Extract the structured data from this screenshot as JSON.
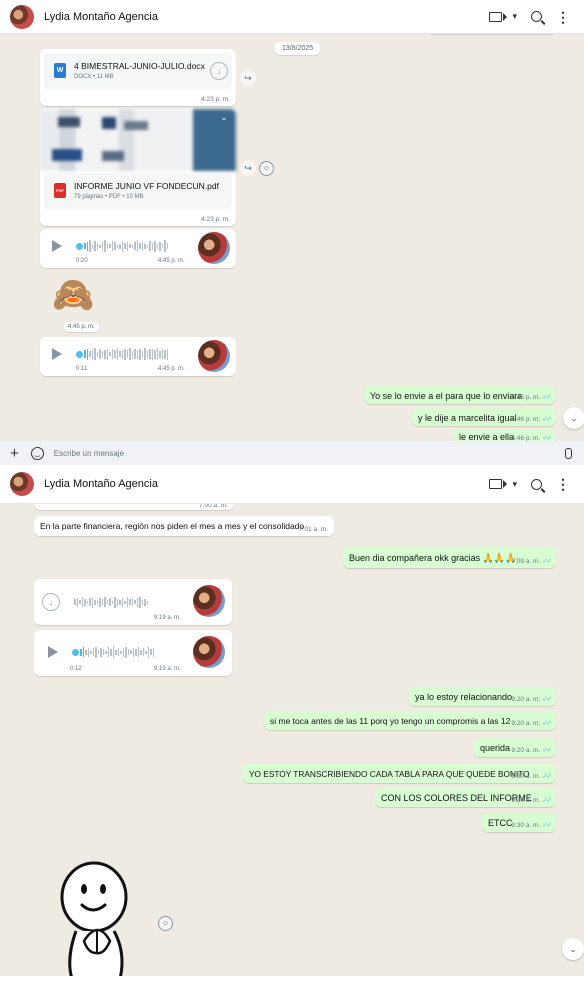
{
  "header": {
    "contact_name": "Lydia Montaño Agencia"
  },
  "pane1": {
    "date_chip": "13/8/2025",
    "doc1": {
      "name": "4 BIMESTRAL-JUNIO-JULIO.docx",
      "meta": "DOCX • 11 MB",
      "time": "4:23 p. m.",
      "icon_label": "W"
    },
    "doc2": {
      "name": "INFORME JUNIO VF FONDECUN.pdf",
      "meta": "79 páginas • PDF • 10 MB",
      "time": "4:23 p. m.",
      "icon_label": "PDF"
    },
    "voice1": {
      "duration": "0:20",
      "time": "4:45 p. m."
    },
    "monkey": {
      "emoji": "🙈",
      "time": "4:45 p. m."
    },
    "voice2": {
      "duration": "0:11",
      "time": "4:45 p. m."
    },
    "out_msgs": [
      {
        "text": "Yo se lo envie a el para que lo enviara",
        "time": "4:46 p. m."
      },
      {
        "text": "y le dije a marcelita igual",
        "time": "4:46 p. m."
      },
      {
        "text": "le envie a ella",
        "time": "4:46 p. m."
      }
    ],
    "composer_placeholder": "Escribe un mensaje"
  },
  "pane2": {
    "top_time": "7:00 a. m.",
    "in_msg": {
      "text": "En la parte financiera, región  nos piden el mes a mes y el consolidado",
      "time": "7:01 a. m."
    },
    "out_msg1": {
      "text": "Buen dia compañera okk gracias 🙏🙏🙏",
      "time": "7:09 a. m."
    },
    "voice1": {
      "time": "9:19 a. m."
    },
    "voice2": {
      "duration": "0:12",
      "time": "9:19 a. m."
    },
    "out_msgs": [
      {
        "text": "ya lo estoy relacionando",
        "time": "9:20 a. m."
      },
      {
        "text": "si me toca antes de las 11 porq yo tengo un compromis a las 12",
        "time": "9:20 a. m."
      },
      {
        "text": "querida",
        "time": "9:20 a. m."
      },
      {
        "text": "YO ESTOY TRANSCRIBIENDO CADA TABLA PARA QUE QUEDE BONITO",
        "time": "9:30 a. m."
      },
      {
        "text": "CON LOS COLORES DEL INFORME",
        "time": "9:30 a. m."
      },
      {
        "text": "ETCC",
        "time": "9:30 a. m."
      }
    ]
  },
  "icons": {
    "forward": "↪",
    "react": "☺",
    "read_ticks": "✓✓",
    "chevron": "⌄",
    "download": "↓"
  },
  "colors": {
    "outgoing_bubble": "#d9fdd3",
    "background": "#efeae2",
    "ticks": "#53bdeb"
  }
}
